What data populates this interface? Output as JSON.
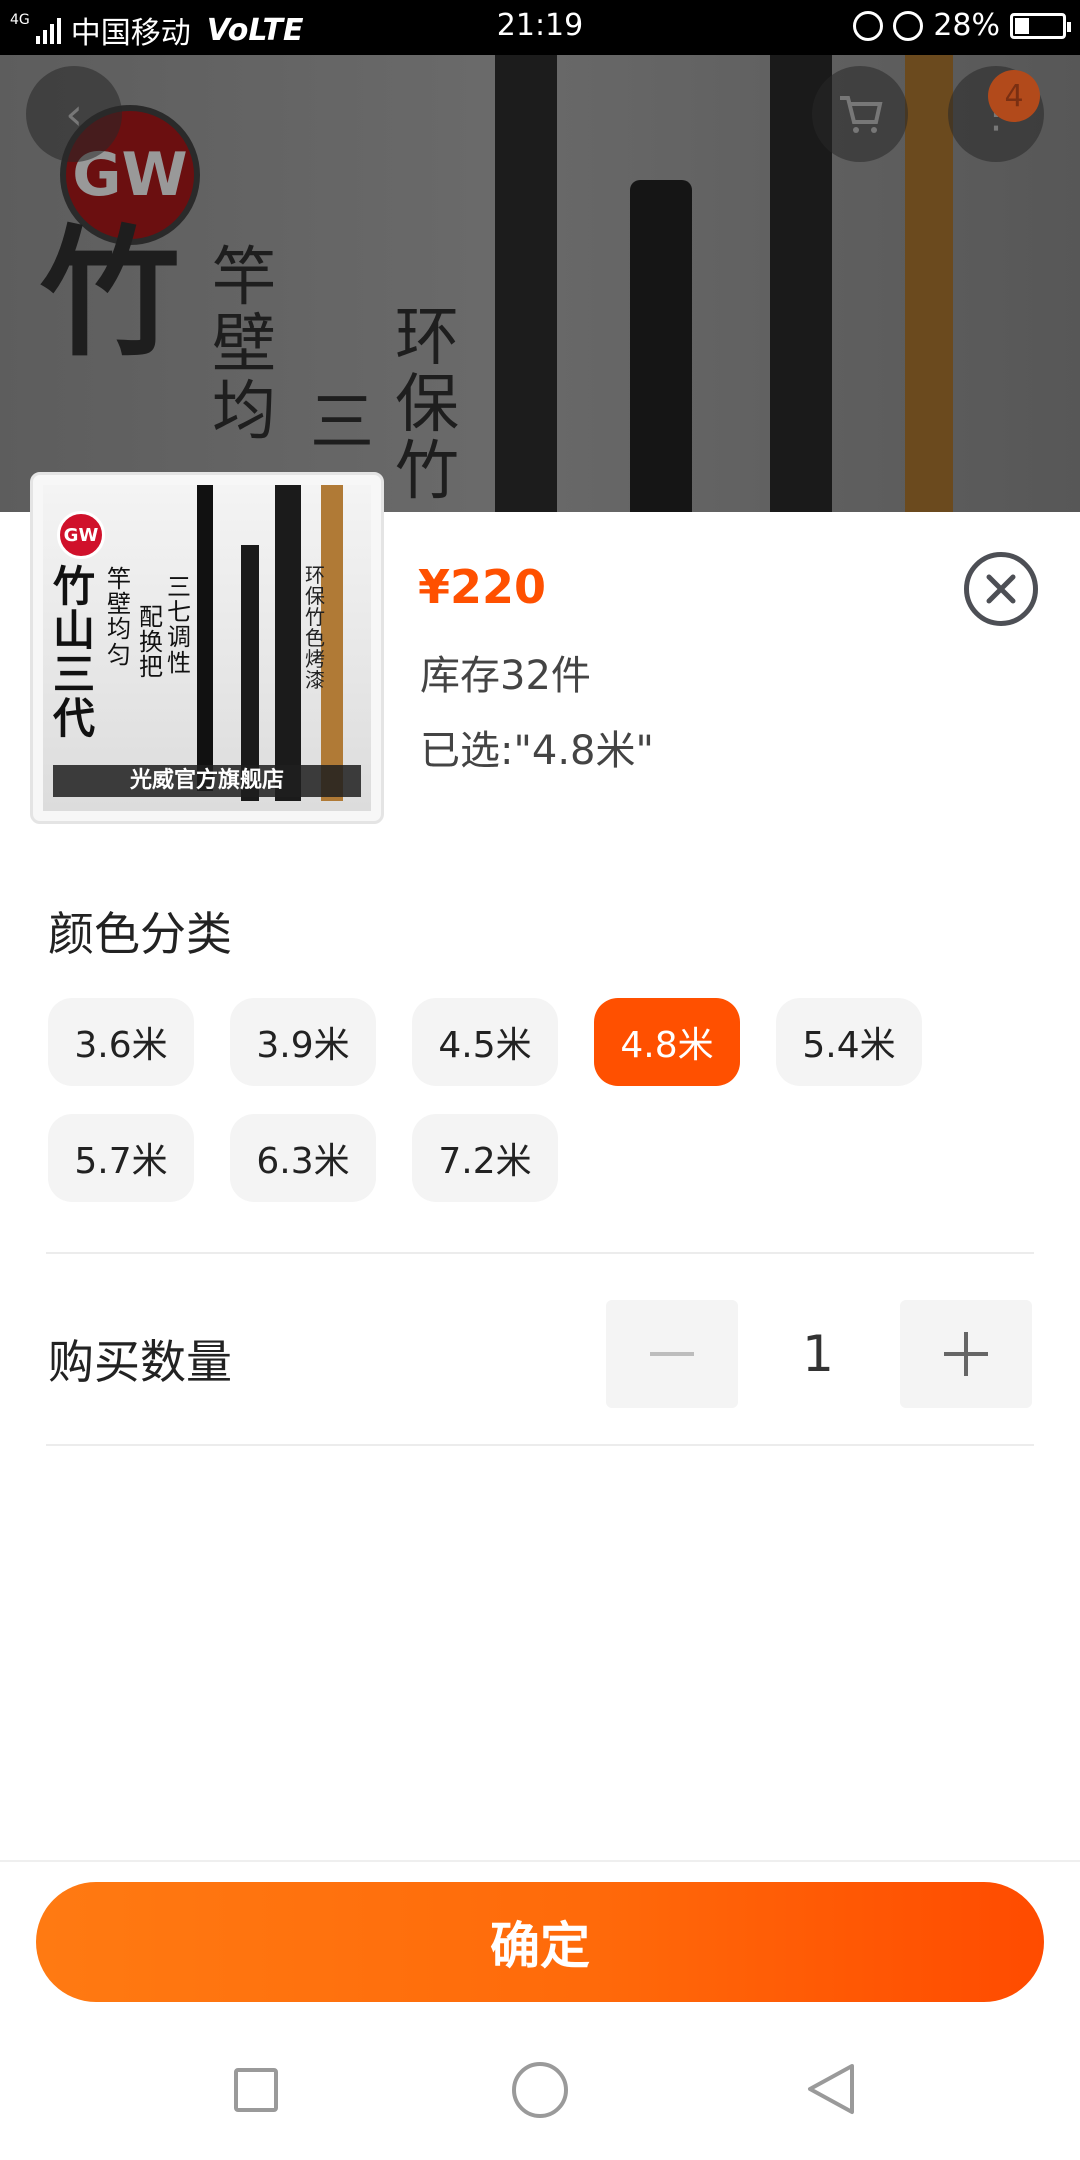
{
  "status_bar": {
    "network": "4G",
    "carrier": "中国移动",
    "volte": "VoLTE",
    "time": "21:19",
    "battery": "28%"
  },
  "background": {
    "brand_logo": "GW",
    "cart_badge": "4",
    "headline_char": "竹",
    "col1": "竿壁均",
    "col2": "三",
    "col3": "环保竹"
  },
  "product": {
    "thumb_logo": "GW",
    "thumb_title": "竹山三代",
    "thumb_col1": "竿壁均匀",
    "thumb_col2": "三七调性",
    "thumb_col3": "环保竹色烤漆",
    "thumb_col4": "配换把",
    "thumb_banner": "光威官方旗舰店",
    "price": "¥220",
    "stock": "库存32件",
    "selected": "已选:\"4.8米\""
  },
  "color_section": {
    "title": "颜色分类",
    "options": [
      "3.6米",
      "3.9米",
      "4.5米",
      "4.8米",
      "5.4米",
      "5.7米",
      "6.3米",
      "7.2米"
    ],
    "selected": "4.8米"
  },
  "quantity": {
    "label": "购买数量",
    "value": "1"
  },
  "confirm_label": "确定",
  "colors": {
    "accent": "#ff5000",
    "button_gradient_start": "#ff7a12",
    "button_gradient_end": "#ff4b00"
  }
}
